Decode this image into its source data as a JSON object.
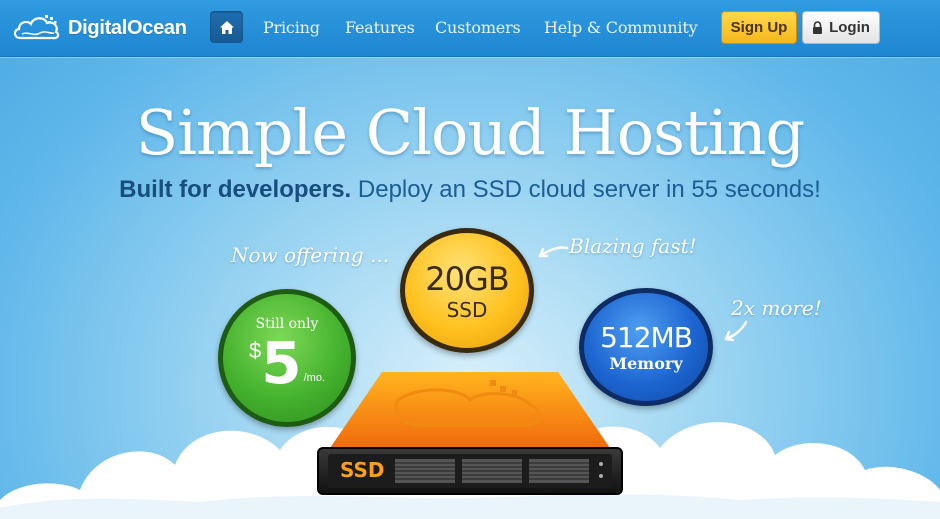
{
  "brand": {
    "name": "DigitalOcean",
    "logo_icon": "cloud-logo-icon"
  },
  "nav": {
    "home_icon": "home-icon",
    "links": [
      "Pricing",
      "Features",
      "Customers",
      "Help & Community"
    ]
  },
  "actions": {
    "signup_label": "Sign Up",
    "login_label": "Login",
    "login_icon": "lock-icon"
  },
  "hero": {
    "title": "Simple Cloud Hosting",
    "subtitle_bold": "Built for developers.",
    "subtitle_rest": "Deploy an SSD cloud server in 55 seconds!"
  },
  "callouts": {
    "now_offering": "Now offering ...",
    "blazing_fast": "Blazing fast!",
    "twice_more": "2x more!"
  },
  "offers": {
    "price": {
      "prefix": "Still only",
      "currency": "$",
      "amount": "5",
      "period": "/mo."
    },
    "storage": {
      "amount": "20GB",
      "label": "SSD"
    },
    "memory": {
      "amount": "512MB",
      "label": "Memory"
    }
  },
  "server": {
    "label": "SSD"
  },
  "colors": {
    "nav": "#2a92da",
    "signup": "#f7c02a",
    "green": "#45b22e",
    "orange": "#ffc21f",
    "blue": "#1d66d1"
  }
}
